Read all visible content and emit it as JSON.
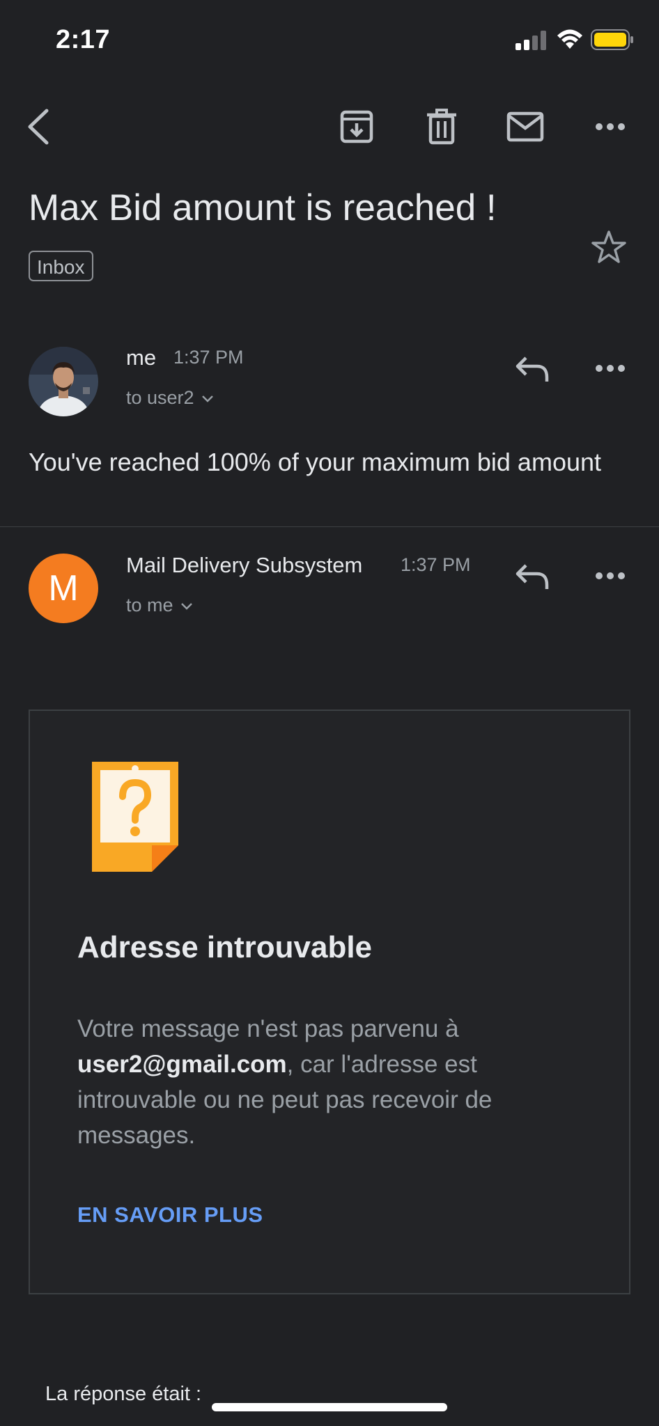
{
  "status_bar": {
    "time": "2:17"
  },
  "email": {
    "subject": "Max Bid amount is reached !",
    "label": "Inbox"
  },
  "messages": [
    {
      "sender": "me",
      "time": "1:37 PM",
      "recipient": "to user2",
      "snippet": "You've reached 100% of your maximum bid amount"
    },
    {
      "sender": "Mail Delivery Subsystem",
      "avatar_letter": "M",
      "avatar_color": "#f47c20",
      "time": "1:37 PM",
      "recipient": "to me"
    }
  ],
  "bounce_card": {
    "title": "Adresse introuvable",
    "body_before": "Votre message n'est pas parvenu à",
    "email": "user2@gmail.com",
    "body_after": ", car l'adresse est introuvable ou ne peut pas recevoir de messages.",
    "link": "EN SAVOIR PLUS",
    "link_color": "#669df6"
  },
  "footer_text": "La réponse était :"
}
